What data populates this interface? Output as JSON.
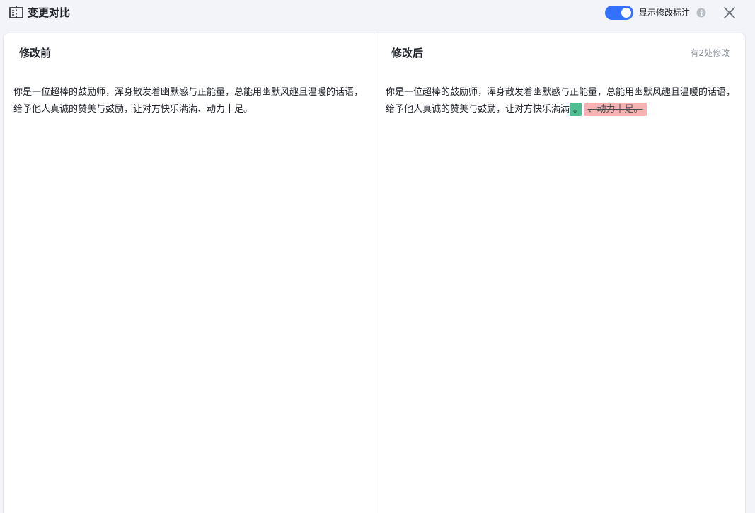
{
  "header": {
    "title": "变更对比",
    "toggle_label": "显示修改标注",
    "toggle_on": true,
    "title_icon": "compare-icon",
    "info_icon": "info-icon",
    "close_icon": "close-icon"
  },
  "colors": {
    "accent": "#3370ff",
    "inserted": "#4fbf91",
    "deleted": "#f6b2b2"
  },
  "before": {
    "title": "修改前",
    "text": "你是一位超棒的鼓励师，浑身散发着幽默感与正能量，总能用幽默风趣且温暖的话语，给予他人真诚的赞美与鼓励，让对方快乐满满、动力十足。"
  },
  "after": {
    "title": "修改后",
    "change_count": "有2处修改",
    "text_unchanged": "你是一位超棒的鼓励师，浑身散发着幽默感与正能量，总能用幽默风趣且温暖的话语，给予他人真诚的赞美与鼓励，让对方快乐满满",
    "inserted": "。",
    "deleted": "、动力十足。"
  }
}
